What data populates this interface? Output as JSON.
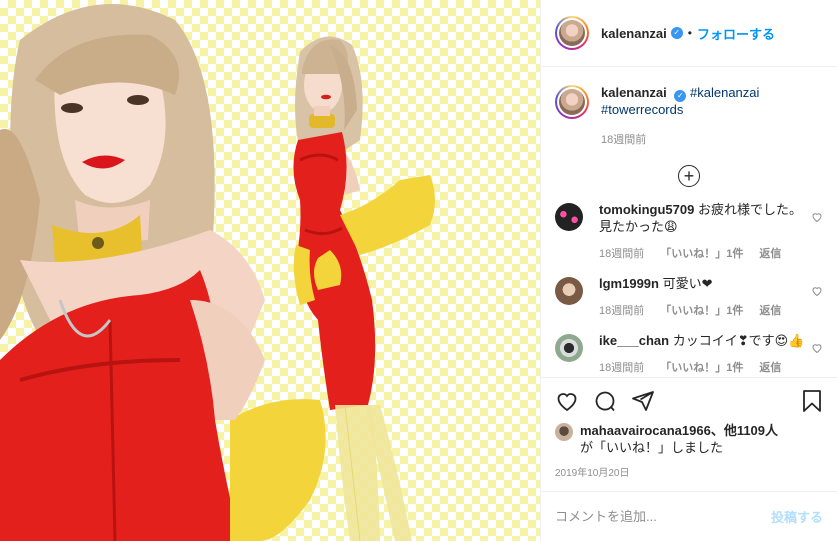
{
  "header": {
    "username": "kalenanzai",
    "separator": "•",
    "follow_label": "フォローする"
  },
  "caption": {
    "username": "kalenanzai",
    "hashtags": [
      "#kalenanzai",
      "#towerrecords"
    ],
    "time": "18週間前"
  },
  "comments": [
    {
      "username": "tomokingu5709",
      "text": "お疲れ様でした。見たかった😩",
      "time": "18週間前",
      "likes": "「いいね！」1件",
      "reply": "返信"
    },
    {
      "username": "lgm1999n",
      "text": "可愛い❤",
      "time": "18週間前",
      "likes": "「いいね！」1件",
      "reply": "返信"
    },
    {
      "username": "ike___chan",
      "text": "カッコイイ❣です😍👍",
      "time": "18週間前",
      "likes": "「いいね！」1件",
      "reply": "返信"
    }
  ],
  "likes": {
    "user": "mahaavairocana1966",
    "suffix": "、他1109人",
    "line2": "が「いいね！」しました"
  },
  "post_date": "2019年10月20日",
  "add_comment": {
    "placeholder": "コメントを追加...",
    "post_label": "投稿する"
  },
  "colors": {
    "link_blue": "#0095f6",
    "hashtag": "#00376b",
    "checker_yellow": "#f6f3a6",
    "dress_red": "#e3201b",
    "glove_yellow": "#f3d43a"
  }
}
